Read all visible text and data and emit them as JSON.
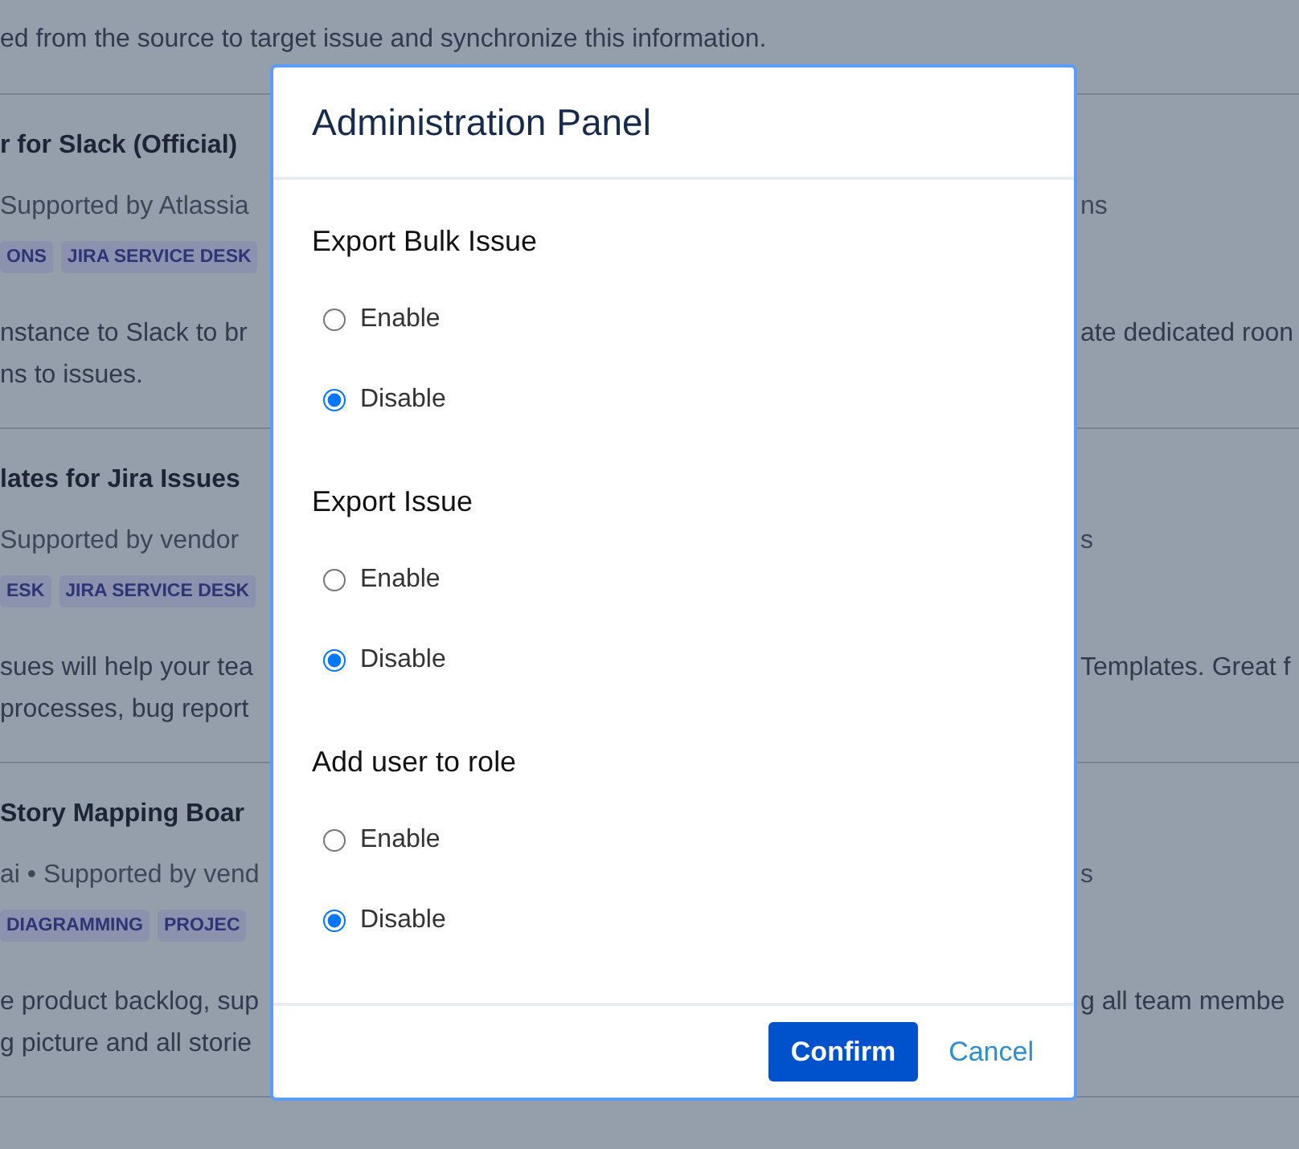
{
  "listing": {
    "intro_lines": [
      "ed from the source to target issue and synchronize this information."
    ],
    "apps": [
      {
        "title": "r for Slack (Official)",
        "meta": "Supported by Atlassia",
        "meta_right": "ns",
        "tags": [
          "ONS",
          "JIRA SERVICE DESK"
        ],
        "description": [
          "nstance to Slack to br",
          "ns to issues."
        ],
        "description_right": "ate dedicated roon"
      },
      {
        "title": "lates for Jira Issues",
        "meta": "Supported by vendor",
        "meta_right": "s",
        "tags": [
          "ESK",
          "JIRA SERVICE DESK"
        ],
        "description": [
          "sues will help your tea",
          "processes, bug report"
        ],
        "description_right": "Templates. Great f"
      },
      {
        "title": "Story Mapping Boar",
        "meta": "ai • Supported by vend",
        "meta_right": "s",
        "tags": [
          "DIAGRAMMING",
          "PROJEC"
        ],
        "description": [
          "e product backlog, sup",
          "g picture and all storie"
        ],
        "description_right": "g all team membe"
      }
    ]
  },
  "modal": {
    "title": "Administration Panel",
    "sections": [
      {
        "heading": "Export Bulk Issue",
        "options": [
          {
            "label": "Enable",
            "selected": false
          },
          {
            "label": "Disable",
            "selected": true
          }
        ]
      },
      {
        "heading": "Export Issue",
        "options": [
          {
            "label": "Enable",
            "selected": false
          },
          {
            "label": "Disable",
            "selected": true
          }
        ]
      },
      {
        "heading": "Add user to role",
        "options": [
          {
            "label": "Enable",
            "selected": false
          },
          {
            "label": "Disable",
            "selected": true
          }
        ]
      }
    ],
    "confirm": "Confirm",
    "cancel": "Cancel"
  }
}
